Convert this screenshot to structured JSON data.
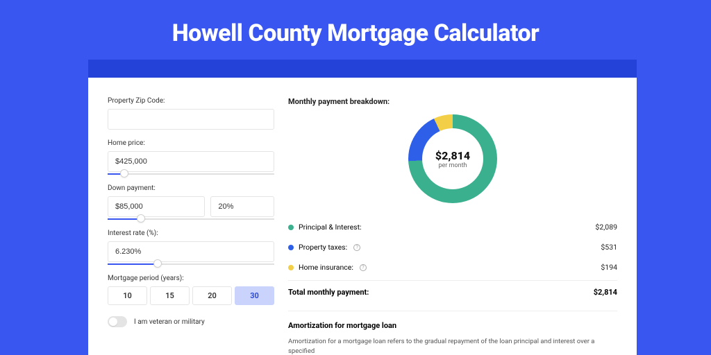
{
  "page_title": "Howell County Mortgage Calculator",
  "inputs": {
    "zip_label": "Property Zip Code:",
    "zip_value": "",
    "home_price_label": "Home price:",
    "home_price_value": "$425,000",
    "home_price_slider_pct": 10,
    "down_payment_label": "Down payment:",
    "down_payment_value": "$85,000",
    "down_payment_pct_value": "20%",
    "down_payment_slider_pct": 20,
    "interest_label": "Interest rate (%):",
    "interest_value": "6.230%",
    "interest_slider_pct": 30,
    "period_label": "Mortgage period (years):",
    "periods": [
      "10",
      "15",
      "20",
      "30"
    ],
    "period_active": "30",
    "veteran_label": "I am veteran or military"
  },
  "breakdown": {
    "title": "Monthly payment breakdown:",
    "center_value": "$2,814",
    "center_sub": "per month",
    "items": [
      {
        "label": "Principal & Interest:",
        "value": "$2,089",
        "color": "green",
        "info": false
      },
      {
        "label": "Property taxes:",
        "value": "$531",
        "color": "blue",
        "info": true
      },
      {
        "label": "Home insurance:",
        "value": "$194",
        "color": "yellow",
        "info": true
      }
    ],
    "total_label": "Total monthly payment:",
    "total_value": "$2,814"
  },
  "amortization": {
    "title": "Amortization for mortgage loan",
    "text": "Amortization for a mortgage loan refers to the gradual repayment of the loan principal and interest over a specified"
  },
  "chart_data": {
    "type": "pie",
    "title": "Monthly payment breakdown",
    "series": [
      {
        "name": "Principal & Interest",
        "value": 2089,
        "color": "#3ab08f"
      },
      {
        "name": "Property taxes",
        "value": 531,
        "color": "#2e5fe8"
      },
      {
        "name": "Home insurance",
        "value": 194,
        "color": "#f2cf47"
      }
    ],
    "total": 2814,
    "inner_label": "$2,814 per month"
  }
}
